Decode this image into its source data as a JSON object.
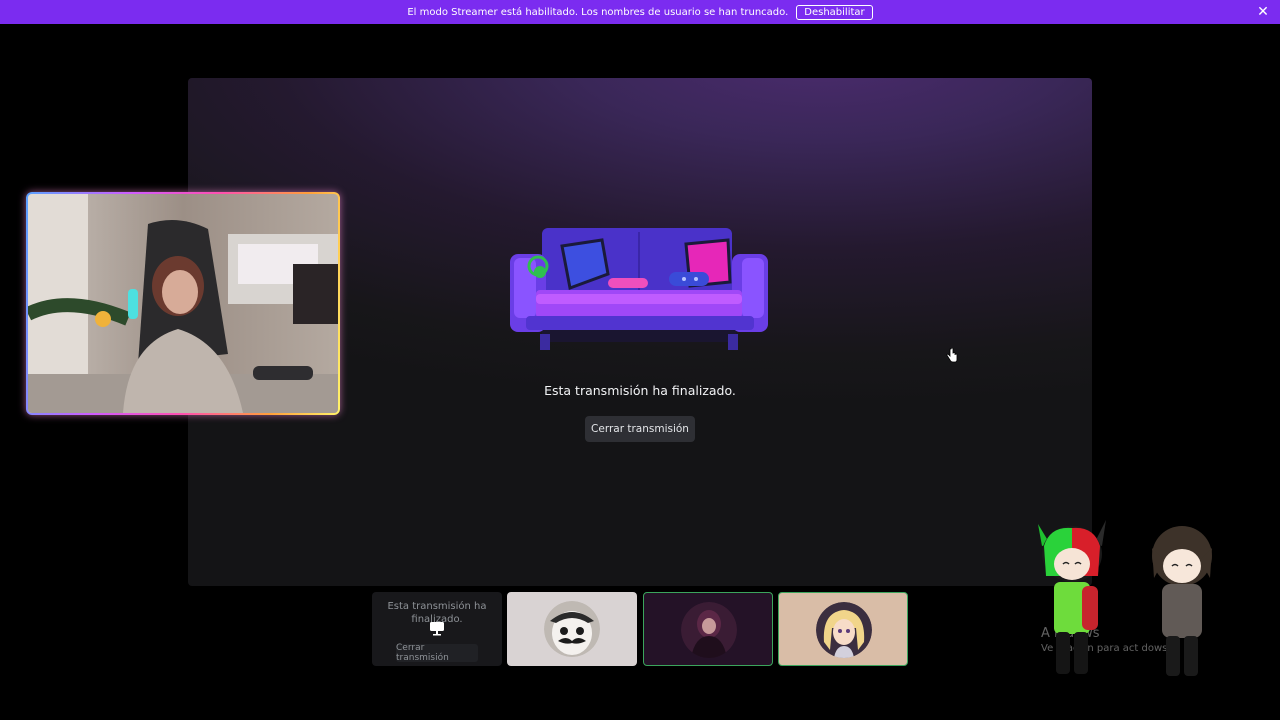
{
  "banner": {
    "message": "El modo Streamer está habilitado. Los nombres de usuario se han truncado.",
    "disable_label": "Deshabilitar",
    "close_icon": "close-icon",
    "color": "#7b2cf0"
  },
  "stage": {
    "message": "Esta transmisión ha finalizado.",
    "close_label": "Cerrar transmisión",
    "illustration": "couch-illustration"
  },
  "thumbnails": [
    {
      "message": "Esta transmisión ha finalizado.",
      "button_label": "Cerrar transmisión",
      "icon": "screen-share-icon"
    },
    {
      "avatar": "masked-character-avatar"
    },
    {
      "avatar": "dark-character-avatar",
      "speaking": true
    },
    {
      "avatar": "blonde-character-avatar",
      "speaking": true
    }
  ],
  "watermark": {
    "line1": "A     indows",
    "line2": "Ve                   uración para act           dows."
  },
  "colors": {
    "speaking_border": "#3ba55c",
    "button_bg": "#2e2f34"
  }
}
